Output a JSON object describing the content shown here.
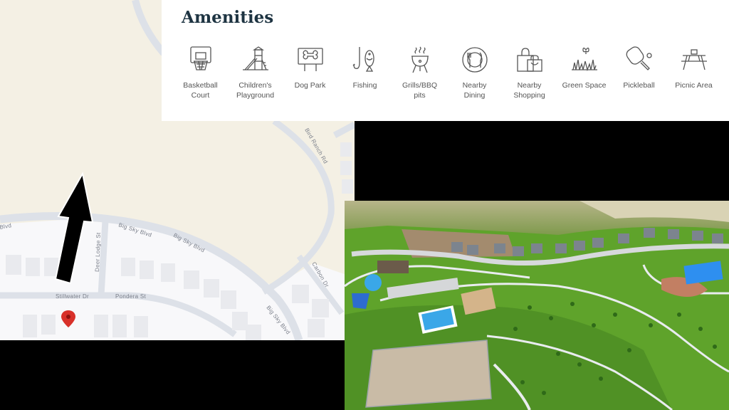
{
  "amenities_panel": {
    "title": "Amenities",
    "items": [
      {
        "label": "Basketball\nCourt",
        "icon": "basketball-hoop-icon"
      },
      {
        "label": "Children's\nPlayground",
        "icon": "playground-icon"
      },
      {
        "label": "Dog Park",
        "icon": "dog-park-sign-icon"
      },
      {
        "label": "Fishing",
        "icon": "fishing-hook-icon"
      },
      {
        "label": "Grills/BBQ\npits",
        "icon": "bbq-grill-icon"
      },
      {
        "label": "Nearby\nDining",
        "icon": "dining-plate-icon"
      },
      {
        "label": "Nearby\nShopping",
        "icon": "shopping-bag-icon"
      },
      {
        "label": "Green Space",
        "icon": "green-space-icon"
      },
      {
        "label": "Pickleball",
        "icon": "pickleball-paddle-icon"
      },
      {
        "label": "Picnic Area",
        "icon": "picnic-table-icon"
      }
    ]
  },
  "map": {
    "streets": {
      "big_sky_1": "Big Sky Blvd",
      "big_sky_2": "Big Sky Blvd",
      "big_sky_3": "Big Sky Blvd",
      "stillwater": "Stillwater Dr",
      "pondera": "Pondera St",
      "deer_lodge": "Deer Lodge St",
      "carbon": "Carbon Dr",
      "blvd_cut": "Blvd",
      "upper": "Bird Ranch Rd"
    },
    "marker_icon": "map-pin-icon",
    "arrow_icon": "arrow-up-icon",
    "colors": {
      "land": "#f4f0e4",
      "block": "#f8f8fa",
      "road": "#dde1e8",
      "building": "#e9eaee",
      "pin": "#d8312a"
    }
  },
  "aerial_photo": {
    "description_icon": "aerial-park-photo",
    "colors": {
      "grass": "#5fa32b",
      "field_dark": "#3e7d1e",
      "pool": "#3aa7e8",
      "path": "#e9ecef"
    }
  }
}
